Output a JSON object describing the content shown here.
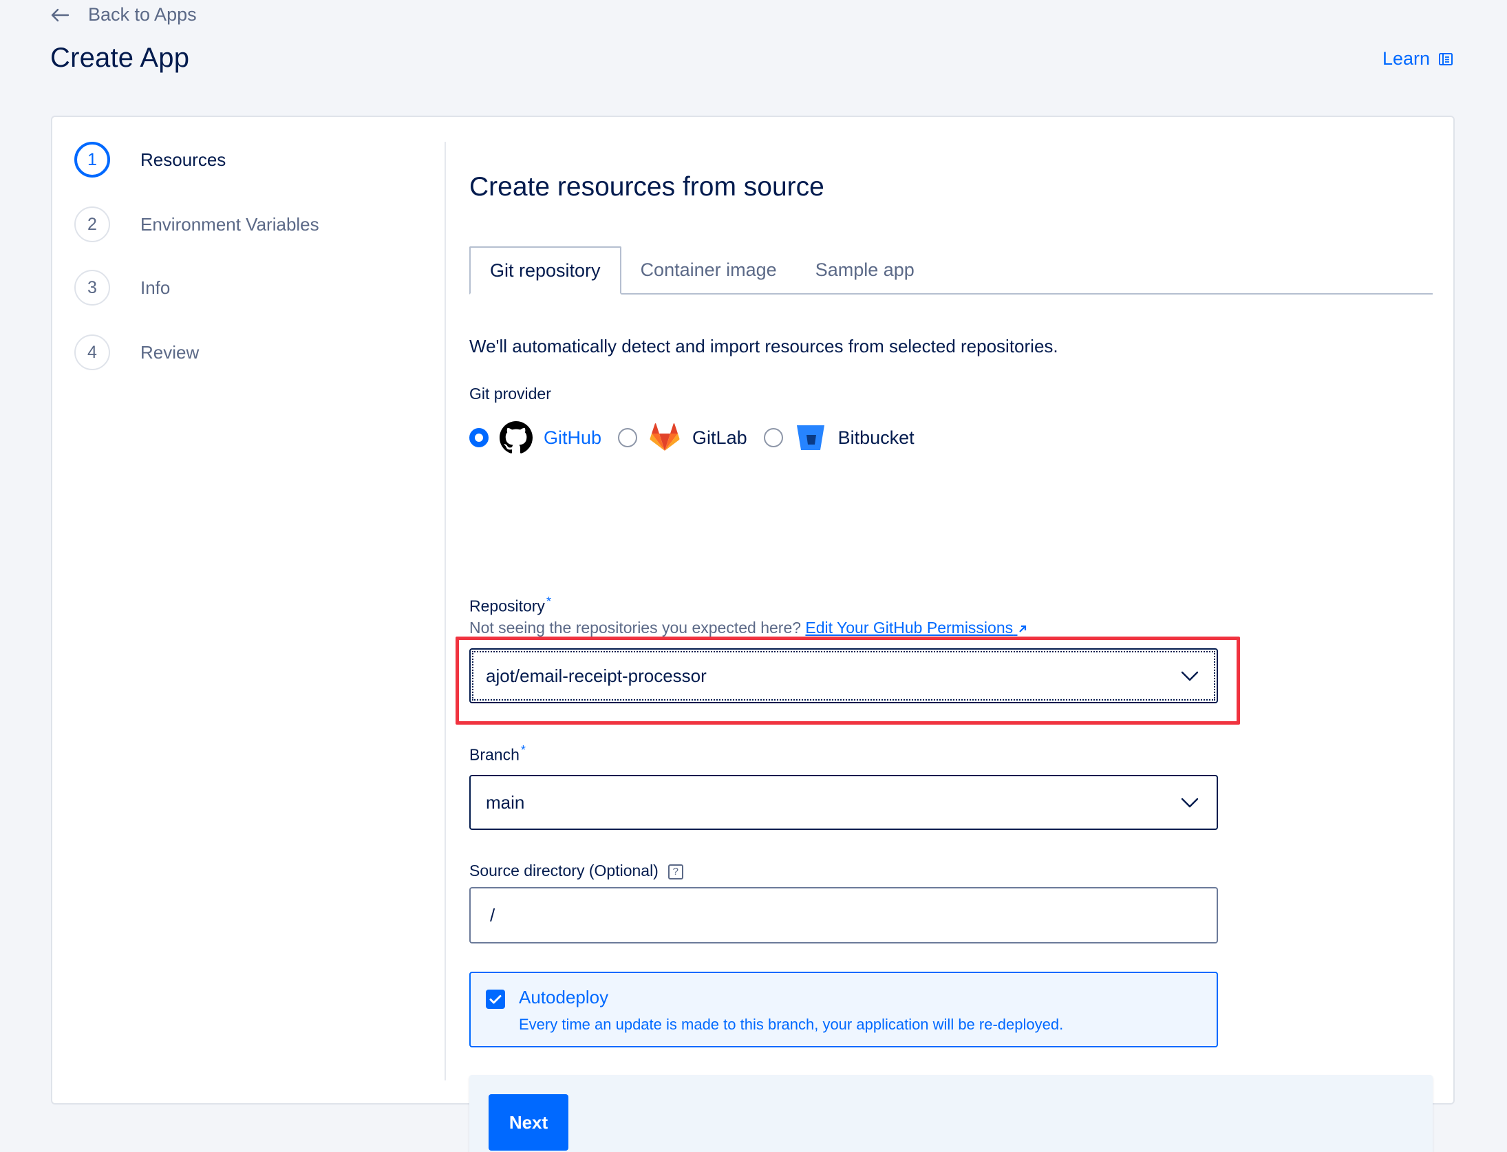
{
  "header": {
    "back_label": "Back to Apps",
    "title": "Create App",
    "learn_label": "Learn"
  },
  "steps": [
    {
      "number": "1",
      "label": "Resources",
      "active": true
    },
    {
      "number": "2",
      "label": "Environment Variables",
      "active": false
    },
    {
      "number": "3",
      "label": "Info",
      "active": false
    },
    {
      "number": "4",
      "label": "Review",
      "active": false
    }
  ],
  "main": {
    "title": "Create resources from source",
    "tabs": [
      {
        "label": "Git repository",
        "active": true
      },
      {
        "label": "Container image",
        "active": false
      },
      {
        "label": "Sample app",
        "active": false
      }
    ],
    "intro": "We'll automatically detect and import resources from selected repositories.",
    "git_provider": {
      "label": "Git provider",
      "options": [
        {
          "name": "GitHub",
          "icon": "github-icon",
          "selected": true
        },
        {
          "name": "GitLab",
          "icon": "gitlab-icon",
          "selected": false
        },
        {
          "name": "Bitbucket",
          "icon": "bitbucket-icon",
          "selected": false
        }
      ]
    },
    "repository": {
      "label": "Repository",
      "required_mark": "*",
      "help_text": "Not seeing the repositories you expected here?",
      "help_link": "Edit Your GitHub Permissions",
      "value": "ajot/email-receipt-processor"
    },
    "branch": {
      "label": "Branch",
      "required_mark": "*",
      "value": "main"
    },
    "source_directory": {
      "label": "Source directory (Optional)",
      "help_icon": "?",
      "value": "/"
    },
    "autodeploy": {
      "checked": true,
      "title": "Autodeploy",
      "description": "Every time an update is made to this branch, your application will be re-deployed."
    },
    "next_label": "Next"
  },
  "colors": {
    "accent": "#0069ff",
    "text": "#031b4e",
    "muted": "#5b6987",
    "highlight": "#f0333f",
    "background": "#f3f5f9"
  }
}
